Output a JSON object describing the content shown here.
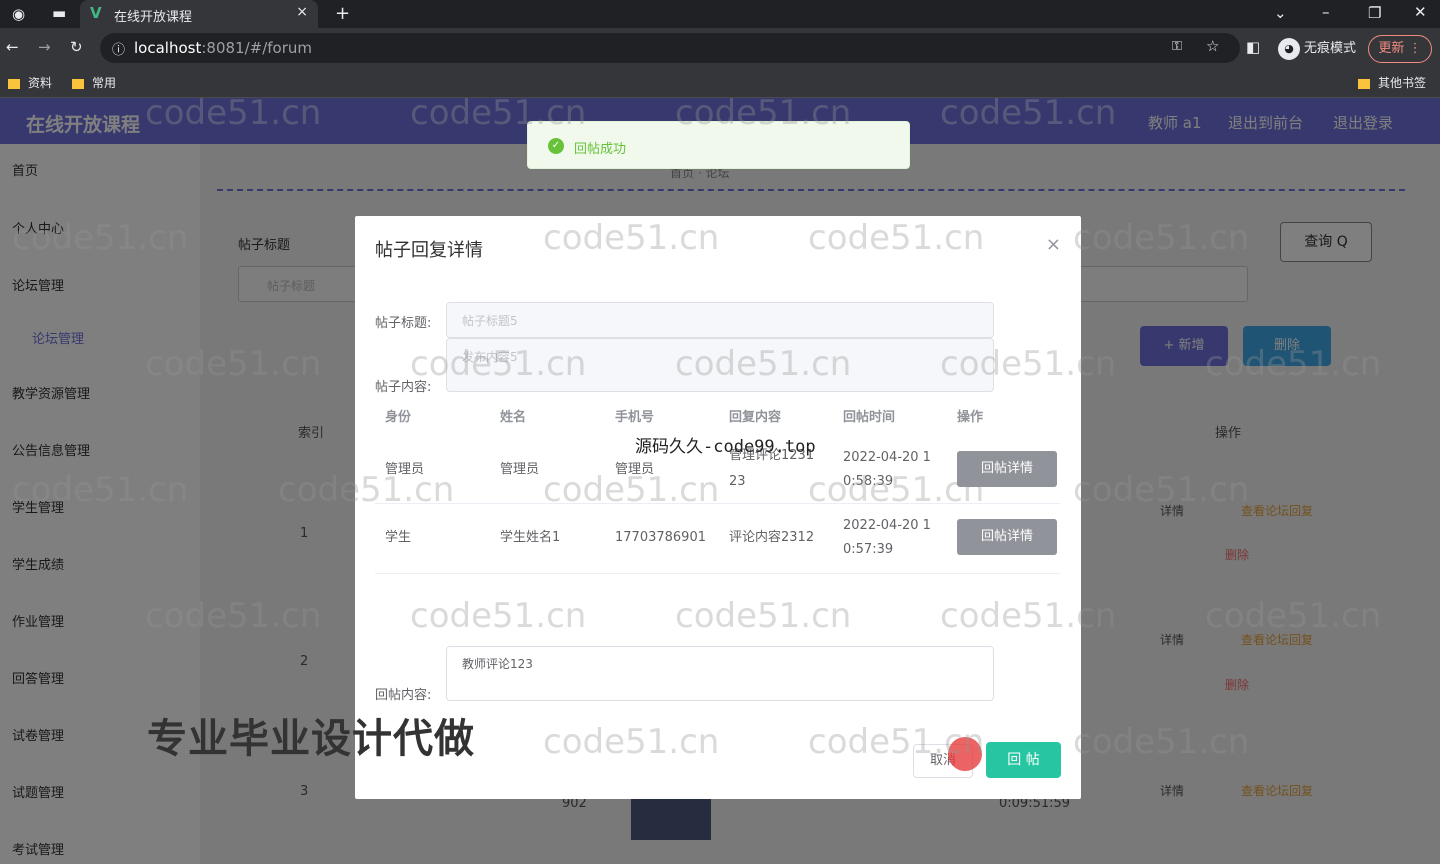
{
  "browser": {
    "tab_title": "在线开放课程",
    "tab_close": "×",
    "new_tab": "+",
    "url_host": "localhost",
    "url_path": ":8081/#/forum",
    "incognito_label": "无痕模式",
    "update_label": "更新",
    "bookmarks": [
      "资料",
      "常用"
    ],
    "other_bookmarks": "其他书签"
  },
  "app": {
    "logo": "在线开放课程",
    "header_links": [
      "教师 a1",
      "退出到前台",
      "退出登录"
    ],
    "sidebar": {
      "items": [
        "首页",
        "个人中心",
        "论坛管理",
        "教学资源管理",
        "公告信息管理",
        "学生管理",
        "学生成绩",
        "作业管理",
        "回答管理",
        "试卷管理",
        "试题管理",
        "考试管理"
      ],
      "sub_item": "论坛管理"
    },
    "breadcrumb": "首页 · 论坛",
    "filter_label": "帖子标题",
    "filter_placeholder": "帖子标题",
    "query_button": "查询 Q",
    "add_button": "+ 新增",
    "delete_button": "删除",
    "bg_index_header": "索引",
    "bg_action_header": "操作",
    "bg_rows": [
      "1",
      "2",
      "3"
    ],
    "bg_row_detail": "详情",
    "bg_row_delete": "删除",
    "bg_row_view": "查看论坛回复",
    "bg_cell_902": "902",
    "bg_cell_time": "0:09:51:59"
  },
  "toast": {
    "message": "回帖成功",
    "icon": "check-circle-icon"
  },
  "dialog": {
    "title": "帖子回复详情",
    "close": "×",
    "title_label": "帖子标题:",
    "title_value": "帖子标题5",
    "content_label": "帖子内容:",
    "content_value": "发布内容5",
    "columns": [
      "身份",
      "姓名",
      "手机号",
      "回复内容",
      "回帖时间",
      "操作"
    ],
    "rows": [
      {
        "role": "管理员",
        "name": "管理员",
        "phone": "管理员",
        "content_line1": "管理评论1231",
        "content_line2": "23",
        "time_line1": "2022-04-20 1",
        "time_line2": "0:58:39",
        "action": "回帖详情"
      },
      {
        "role": "学生",
        "name": "学生姓名1",
        "phone": "17703786901",
        "content_line1": "评论内容2312",
        "content_line2": "",
        "time_line1": "2022-04-20 1",
        "time_line2": "0:57:39",
        "action": "回帖详情"
      }
    ],
    "reply_label": "回帖内容:",
    "reply_value": "教师评论123",
    "cancel_label": "取消",
    "submit_label": "回 帖"
  },
  "watermarks": {
    "site": "code51.cn",
    "center": "源码久久-code99.top",
    "promo": "专业毕业设计代做"
  }
}
